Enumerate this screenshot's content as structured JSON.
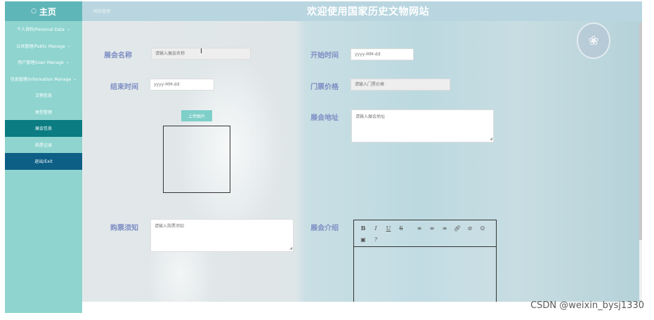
{
  "header": {
    "brand": "主页",
    "breadcrumb": "网站管理",
    "site_title": "欢迎使用国家历史文物网站"
  },
  "sidebar": {
    "items": [
      {
        "label": "个人资料/Personal Data",
        "chevron": true
      },
      {
        "label": "公共管理/Public Manage",
        "chevron": true
      },
      {
        "label": "用户管理/User Manage",
        "chevron": true
      },
      {
        "label": "信息管理/Information Manage",
        "chevron": true
      },
      {
        "label": "文物信息",
        "chevron": false
      },
      {
        "label": "类型管理",
        "chevron": false
      },
      {
        "label": "展会信息",
        "chevron": false,
        "active": true
      },
      {
        "label": "购票记录",
        "chevron": false
      },
      {
        "label": "退出/Exit",
        "chevron": false,
        "exit": true
      }
    ]
  },
  "form": {
    "exhibition_name": {
      "label": "展会名称",
      "placeholder": "请输入展会名称"
    },
    "start_time": {
      "label": "开始时间",
      "placeholder": "yyyy-MM-dd"
    },
    "end_time": {
      "label": "结束时间",
      "placeholder": "yyyy-MM-dd"
    },
    "ticket_price": {
      "label": "门票价格",
      "placeholder": "请输入门票价格"
    },
    "upload": {
      "button": "上传图片"
    },
    "address": {
      "label": "展会地址",
      "placeholder": "请输入展会地址"
    },
    "notice": {
      "label": "购票须知",
      "placeholder": "请输入购票须知"
    },
    "intro": {
      "label": "展会介绍"
    }
  },
  "editor_toolbar": {
    "bold": "B",
    "italic": "I",
    "underline": "U",
    "strike": "S",
    "help": "?"
  },
  "watermark": "CSDN @weixin_bysj1330",
  "colors": {
    "sidebar_bg": "#8fd4cf",
    "active_item": "#0a7c82",
    "exit_item": "#0d5f86",
    "label": "#7e8ec4",
    "topbar": "#b9d6e0"
  }
}
